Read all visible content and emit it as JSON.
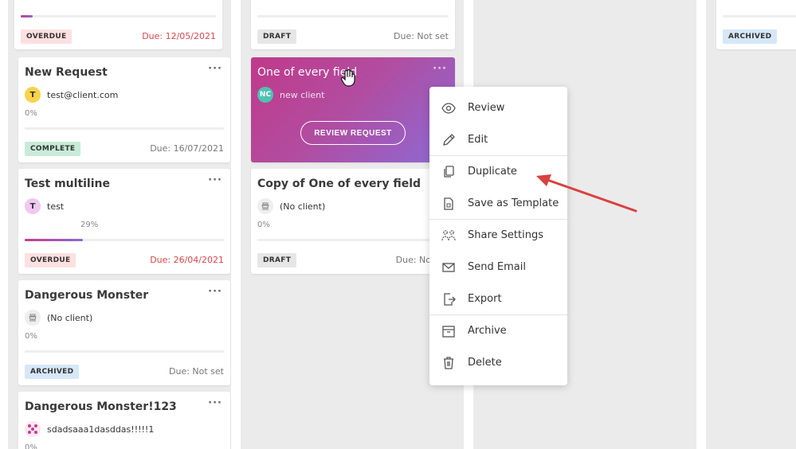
{
  "columns": [
    {
      "cards": [
        {
          "title": "",
          "percent": "6%",
          "status": "OVERDUE",
          "due": "Due: 12/05/2021"
        },
        {
          "title": "New Request",
          "menu": "···",
          "client_initial": "T",
          "client": "test@client.com",
          "percent": "0%",
          "status": "COMPLETE",
          "due": "Due: 16/07/2021"
        },
        {
          "title": "Test multiline",
          "menu": "···",
          "client_initial": "T",
          "client": "test",
          "percent": "29%",
          "progress_fraction": 0.29,
          "status": "OVERDUE",
          "due": "Due: 26/04/2021"
        },
        {
          "title": "Dangerous Monster",
          "menu": "···",
          "client": "(No client)",
          "percent": "0%",
          "status": "ARCHIVED",
          "due": "Due: Not set"
        },
        {
          "title": "Dangerous Monster!123",
          "menu": "···",
          "client": "sdadsaaa1dasddas!!!!!1",
          "percent": "0%"
        }
      ]
    },
    {
      "cards": [
        {
          "title": "",
          "percent": "0%",
          "status": "DRAFT",
          "due": "Due: Not set"
        },
        {
          "title": "One of every field",
          "menu": "···",
          "client_initial": "NC",
          "client": "new client",
          "button": "REVIEW REQUEST"
        },
        {
          "title": "Copy of One of every field",
          "client": "(No client)",
          "percent": "0%",
          "status": "DRAFT",
          "due": "Due: No"
        }
      ]
    },
    {
      "cards": []
    },
    {
      "cards": [
        {
          "percent": "0%",
          "status": "ARCHIVED"
        }
      ]
    }
  ],
  "context_menu": {
    "items": [
      {
        "label": "Review",
        "icon": "eye-icon"
      },
      {
        "label": "Edit",
        "icon": "pencil-icon"
      },
      {
        "label": "Duplicate",
        "icon": "copy-icon"
      },
      {
        "label": "Save as Template",
        "icon": "template-icon"
      },
      {
        "label": "Share Settings",
        "icon": "users-icon"
      },
      {
        "label": "Send Email",
        "icon": "mail-icon"
      },
      {
        "label": "Export",
        "icon": "export-icon"
      },
      {
        "label": "Archive",
        "icon": "archive-icon"
      },
      {
        "label": "Delete",
        "icon": "trash-icon"
      }
    ]
  },
  "colors": {
    "accent_gradient_start": "#c0398a",
    "accent_gradient_end": "#8b6bd6",
    "overdue_text": "#e0454a",
    "annotation_arrow": "#d9413f"
  }
}
